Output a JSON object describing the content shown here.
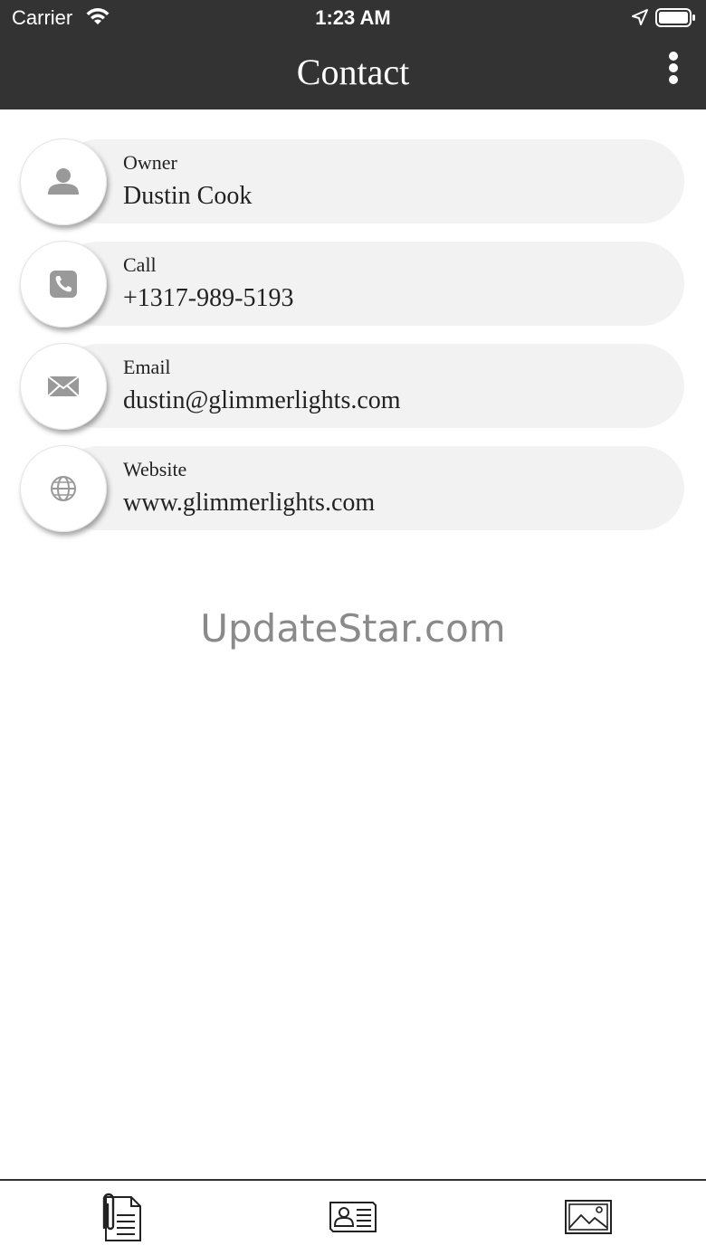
{
  "status_bar": {
    "carrier": "Carrier",
    "time": "1:23 AM"
  },
  "header": {
    "title": "Contact"
  },
  "contacts": [
    {
      "label": "Owner",
      "value": "Dustin Cook",
      "icon": "person-icon"
    },
    {
      "label": "Call",
      "value": "+1317-989-5193",
      "icon": "phone-icon"
    },
    {
      "label": "Email",
      "value": "dustin@glimmerlights.com",
      "icon": "envelope-icon"
    },
    {
      "label": "Website",
      "value": "www.glimmerlights.com",
      "icon": "globe-icon"
    }
  ],
  "watermark": "UpdateStar.com",
  "tabbar": {
    "tabs": [
      "document-attachment-icon",
      "contact-card-icon",
      "image-gallery-icon"
    ]
  },
  "colors": {
    "header_bg": "#333333",
    "pill_bg": "#f2f2f2",
    "icon_gray": "#999999"
  }
}
